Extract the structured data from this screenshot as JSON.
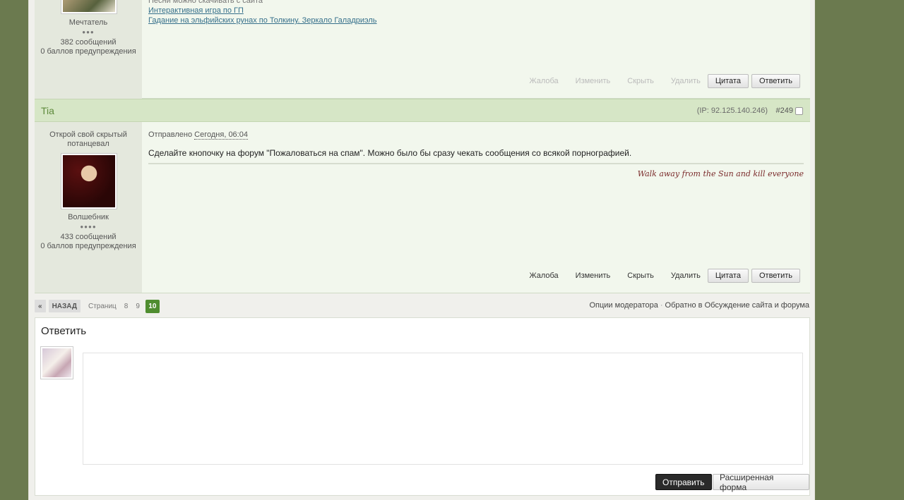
{
  "post_prev": {
    "links": [
      {
        "text": "Песни можно скачивать с сайта "
      },
      {
        "text": "Интерактивная игра по ГП"
      },
      {
        "text": "Гадание на эльфийских рунах по Толкину. Зеркало Галадриэль"
      }
    ],
    "rank": "Мечтатель",
    "dots": "●●●",
    "posts": "382 сообщений",
    "warnings": "0 баллов предупреждения",
    "actions": {
      "report": "Жалоба",
      "edit": "Изменить",
      "hide": "Скрыть",
      "delete": "Удалить",
      "quote": "Цитата",
      "reply": "Ответить"
    }
  },
  "post": {
    "author": "Tia",
    "ip": "(IP: 92.125.140.246)",
    "number": "#249",
    "title_line": "Открой свой скрытый потанцевал",
    "rank": "Волшебник",
    "dots": "●●●●",
    "posts": "433 сообщений",
    "warnings": "0 баллов предупреждения",
    "sent_label": "Отправлено",
    "sent_date": "Сегодня, 06:04",
    "message": "Сделайте кнопочку на форум \"Пожаловаться на спам\". Можно было бы сразу чекать сообщения со всякой порнографией.",
    "signature": "Walk away from the Sun and kill everyone",
    "actions": {
      "report": "Жалоба",
      "edit": "Изменить",
      "hide": "Скрыть",
      "delete": "Удалить",
      "quote": "Цитата",
      "reply": "Ответить"
    }
  },
  "pager": {
    "first": "«",
    "back": "НАЗАД",
    "label": "Страниц",
    "pages": [
      "8",
      "9"
    ],
    "current": "10"
  },
  "mod": {
    "options": "Опции модератора",
    "sep": "·",
    "back_to": "Обратно в Обсуждение сайта и форума"
  },
  "reply": {
    "title": "Ответить",
    "submit": "Отправить",
    "advanced": "Расширенная форма"
  },
  "colors": {
    "accent": "#4f8d2f",
    "page_bg": "#6b7a4f",
    "header_bg": "#d6e6c6"
  }
}
